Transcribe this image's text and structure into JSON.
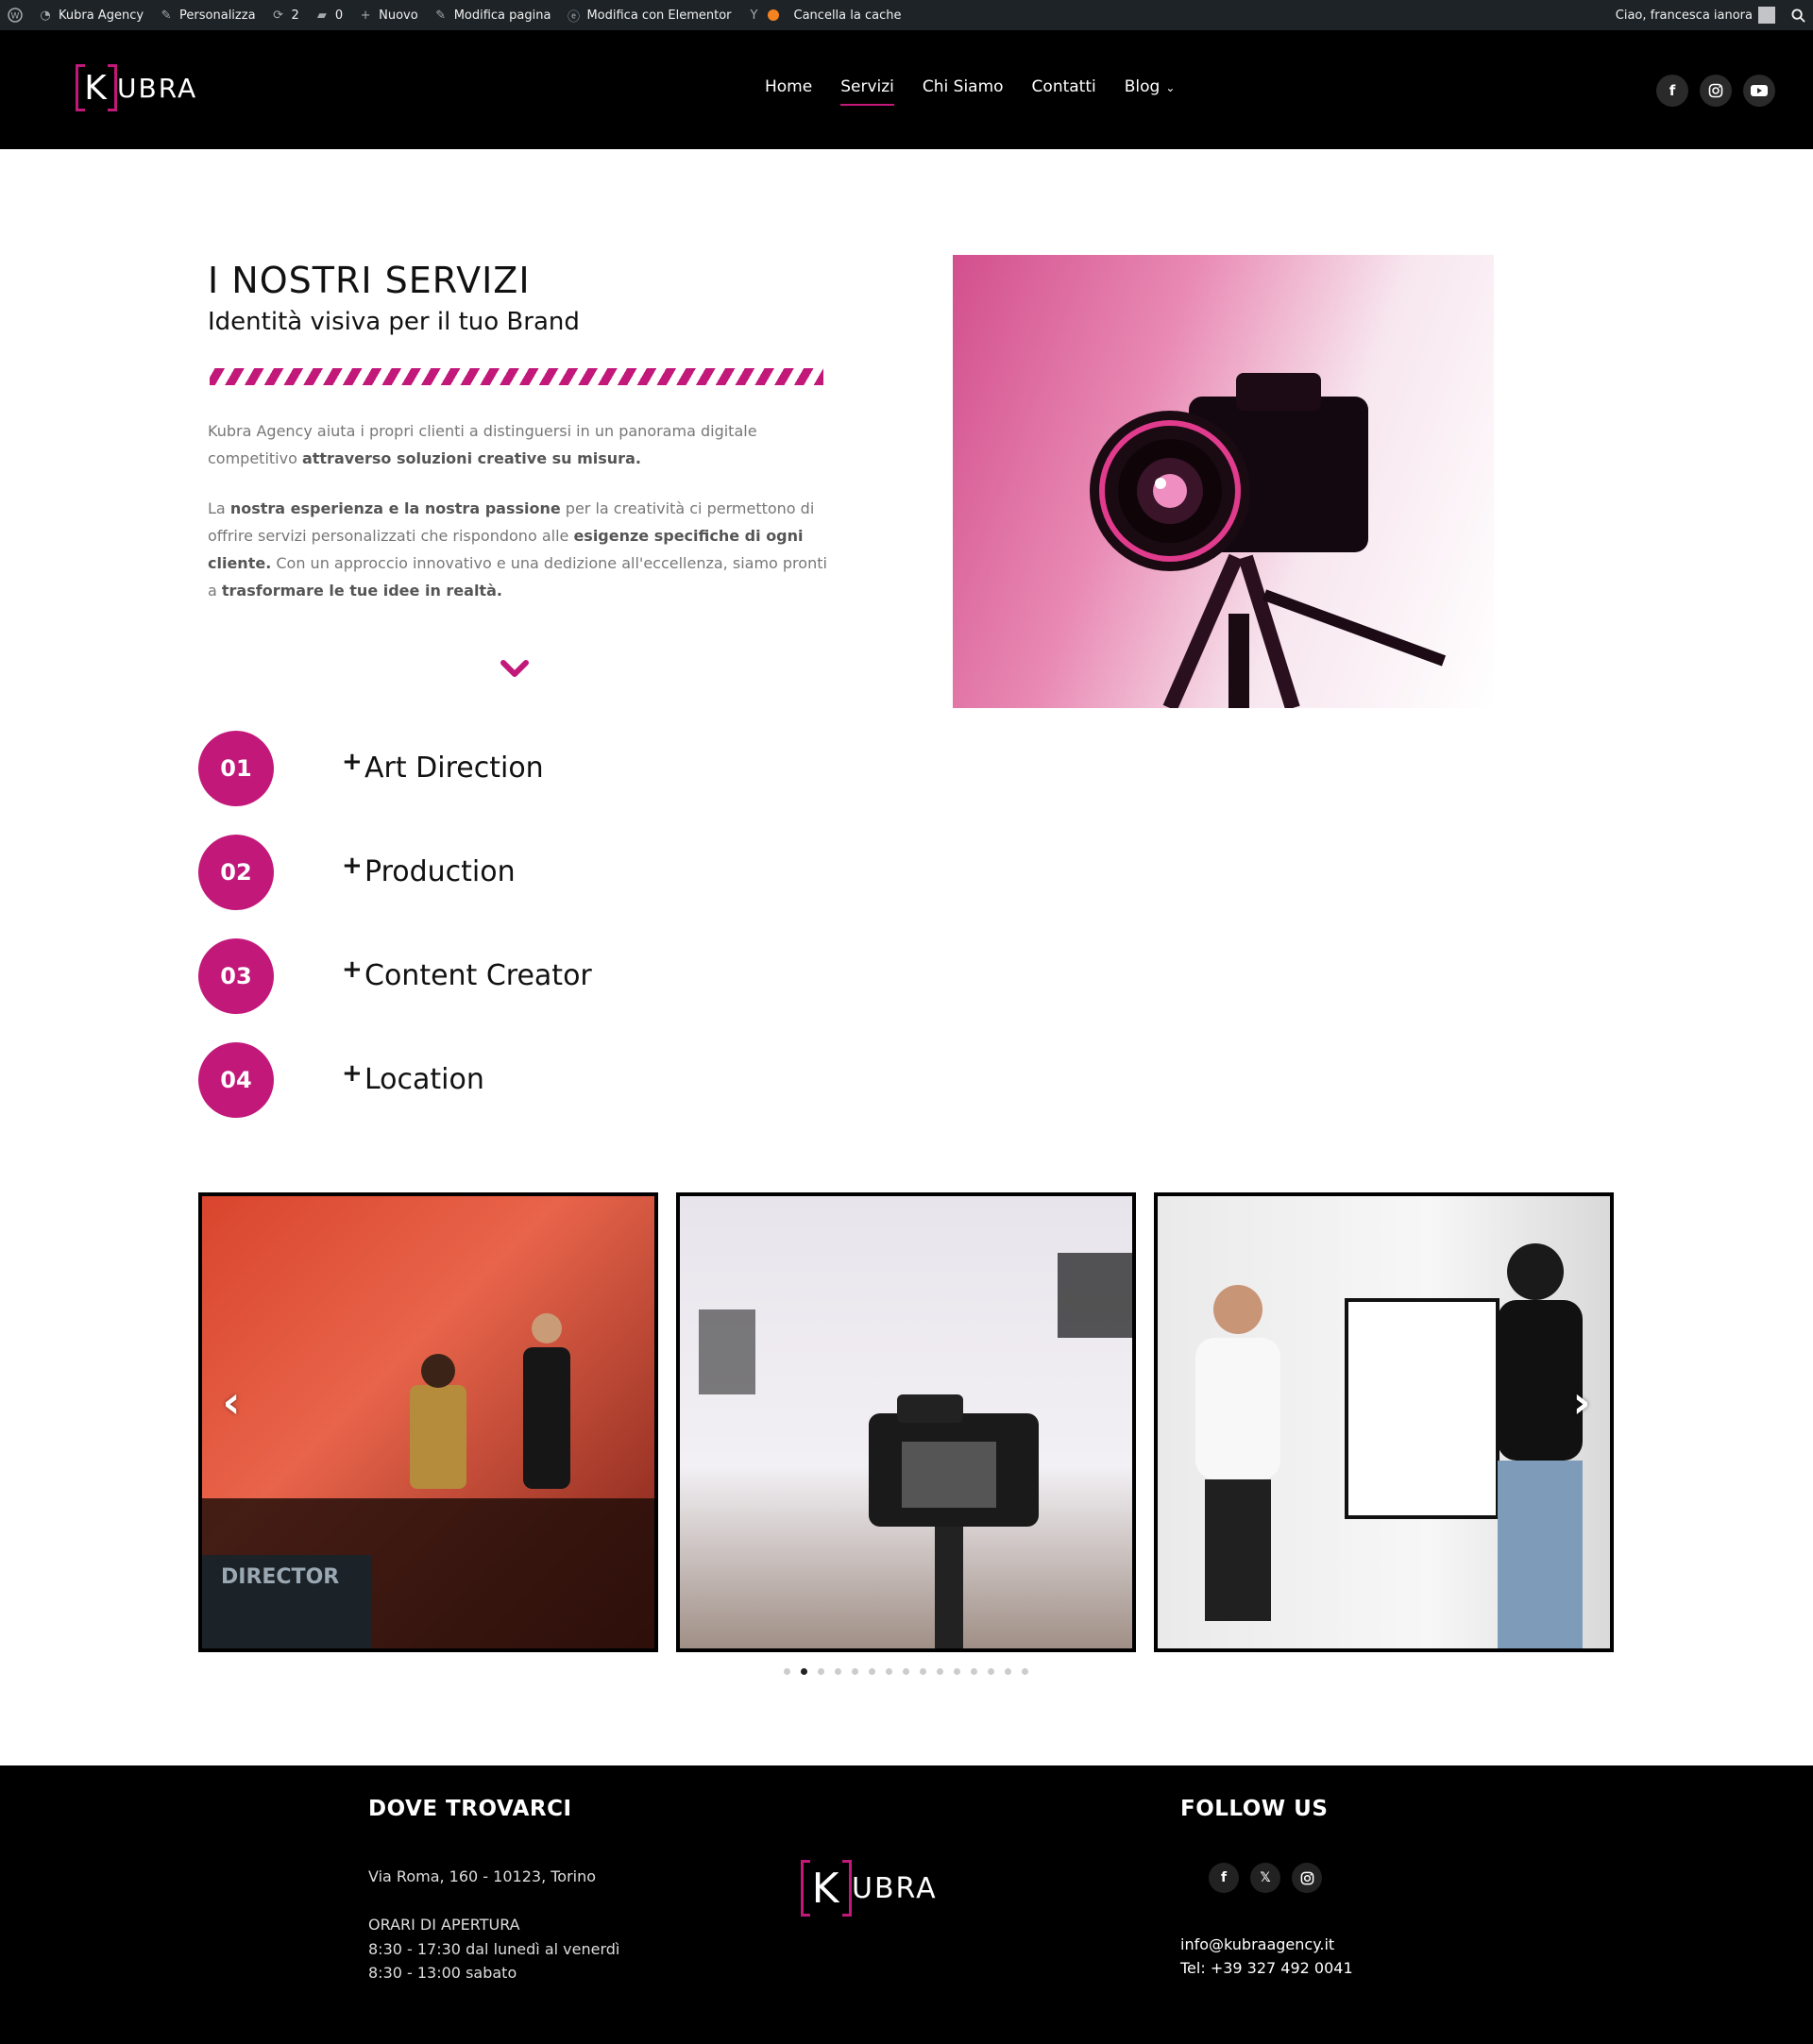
{
  "admin_bar": {
    "site_name": "Kubra Agency",
    "customize": "Personalizza",
    "updates_count": "2",
    "comments_count": "0",
    "new": "Nuovo",
    "edit_page": "Modifica pagina",
    "edit_elementor": "Modifica con Elementor",
    "clear_cache": "Cancella la cache",
    "greeting": "Ciao, francesca ianora"
  },
  "logo": {
    "bracket_letter": "K",
    "rest": "UBRA",
    "bracket_color": "#c2187a"
  },
  "nav": {
    "items": [
      {
        "label": "Home",
        "active": false
      },
      {
        "label": "Servizi",
        "active": true
      },
      {
        "label": "Chi Siamo",
        "active": false
      },
      {
        "label": "Contatti",
        "active": false
      },
      {
        "label": "Blog",
        "active": false
      }
    ]
  },
  "header_social": [
    "facebook-icon",
    "instagram-icon",
    "youtube-icon"
  ],
  "intro": {
    "title": "I NOSTRI SERVIZI",
    "subtitle": "Identità visiva per il tuo Brand",
    "p1_a": "Kubra Agency aiuta i propri clienti a distinguersi in un panorama digitale competitivo ",
    "p1_b": "attraverso soluzioni creative su misura.",
    "p2_a": "La ",
    "p2_b": "nostra esperienza e la nostra passione",
    "p2_c": " per la creatività ci permettono di offrire servizi personalizzati che rispondono alle ",
    "p2_d": "esigenze specifiche di ogni cliente.",
    "p2_e": " Con un approccio innovativo e una dedizione all'eccellenza, siamo pronti a ",
    "p2_f": "trasformare le tue idee in realtà."
  },
  "services": [
    {
      "num": "01",
      "label": "Art Direction"
    },
    {
      "num": "02",
      "label": "Production"
    },
    {
      "num": "03",
      "label": "Content Creator"
    },
    {
      "num": "04",
      "label": "Location"
    }
  ],
  "carousel": {
    "total_dots": 15,
    "active_dot": 1
  },
  "footer": {
    "where_title": "DOVE TROVARCI",
    "address": "Via Roma, 160 - 10123, Torino",
    "hours_title": "ORARI DI APERTURA",
    "hours_1": "8:30 - 17:30 dal lunedì al venerdì",
    "hours_2": "8:30 - 13:00 sabato",
    "follow_title": "FOLLOW US",
    "email": "info@kubraagency.it",
    "phone": "Tel: +39 327 492 0041"
  },
  "colors": {
    "accent": "#c2187a",
    "header_bg": "#000000",
    "admin_bg": "#1d2327"
  }
}
